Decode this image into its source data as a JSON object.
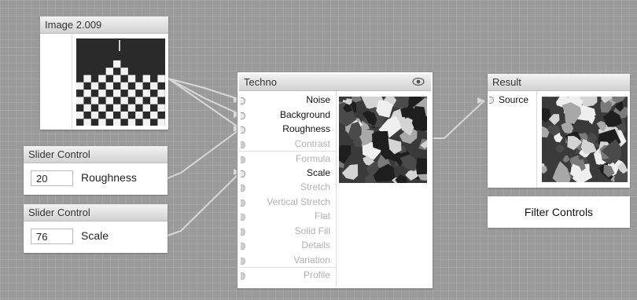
{
  "nodes": {
    "image": {
      "title": "Image 2.009"
    },
    "slider_1": {
      "title": "Slider Control",
      "value": "20",
      "label": "Roughness"
    },
    "slider_2": {
      "title": "Slider Control",
      "value": "76",
      "label": "Scale"
    },
    "techno": {
      "title": "Techno",
      "inputs": [
        {
          "label": "Noise",
          "connected": true
        },
        {
          "label": "Background",
          "connected": true
        },
        {
          "label": "Roughness",
          "connected": true
        },
        {
          "label": "Contrast",
          "connected": false
        },
        {
          "label": "Formula",
          "connected": false
        },
        {
          "label": "Scale",
          "connected": true
        },
        {
          "label": "Stretch",
          "connected": false
        },
        {
          "label": "Vertical Stretch",
          "connected": false
        },
        {
          "label": "Flat",
          "connected": false
        },
        {
          "label": "Solid Fill",
          "connected": false
        },
        {
          "label": "Details",
          "connected": false
        },
        {
          "label": "Variation",
          "connected": false
        },
        {
          "label": "Profile",
          "connected": false
        }
      ]
    },
    "result": {
      "title": "Result",
      "input_label": "Source"
    }
  },
  "filter_controls": {
    "label": "Filter Controls"
  },
  "icons": {
    "preview_toggle": "eye-icon"
  },
  "colors": {
    "canvas": "#9a9a9a",
    "wire": "#d8d8d8",
    "header": "#dadada"
  }
}
